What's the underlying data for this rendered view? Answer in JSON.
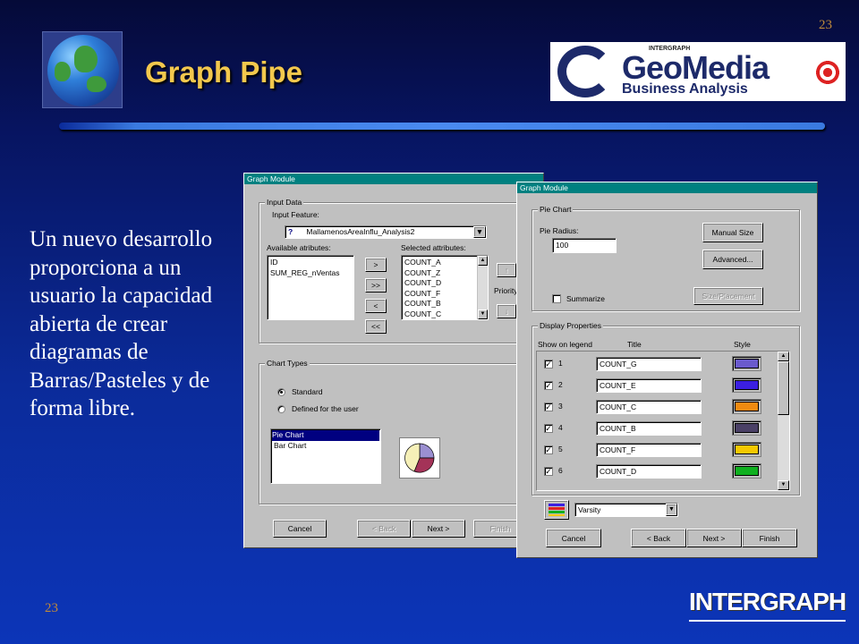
{
  "slide": {
    "page_number": "23",
    "title": "Graph Pipe",
    "body_text": "Un nuevo desarrollo proporciona a un usuario la capacidad abierta de crear diagramas de Barras/Pasteles y de forma libre.",
    "logo": {
      "small": "INTERGRAPH",
      "main": "GeoMedia",
      "sub": "Business Analysis"
    },
    "brand": "INTERGRAPH",
    "colors": {
      "title": "#f3c84d",
      "page_number": "#c08a3a",
      "titlebar": "#008080"
    }
  },
  "window1": {
    "title": "Graph Module",
    "input_data": {
      "group_label": "Input Data",
      "feature_label": "Input Feature:",
      "feature_value": "MallamenosAreaInflu_Analysis2",
      "available_label": "Available atributes:",
      "available": [
        "ID",
        "SUM_REG_nVentas"
      ],
      "selected_label": "Selected attributes:",
      "selected": [
        "COUNT_A",
        "COUNT_Z",
        "COUNT_D",
        "COUNT_F",
        "COUNT_B",
        "COUNT_C"
      ],
      "move_buttons": [
        ">",
        ">>",
        "<",
        "<<"
      ],
      "priority_label": "Priority"
    },
    "chart_types": {
      "group_label": "Chart Types",
      "standard": "Standard",
      "defined": "Defined for the user",
      "list": [
        "Pie Chart",
        "Bar Chart"
      ]
    },
    "buttons": {
      "cancel": "Cancel",
      "back": "< Back",
      "next": "Next >",
      "finish": "Finish"
    }
  },
  "window2": {
    "title": "Graph Module",
    "pie_chart": {
      "group_label": "Pie Chart",
      "radius_label": "Pie Radius:",
      "radius_value": "100",
      "manual_size": "Manual Size",
      "advanced": "Advanced...",
      "summarize": "Summarize",
      "size_placement": "Size/Placement"
    },
    "display": {
      "group_label": "Display Properties",
      "col_legend": "Show on legend",
      "col_title": "Title",
      "col_style": "Style",
      "rows": [
        {
          "num": "1",
          "title": "COUNT_G",
          "color": "#6a5acd"
        },
        {
          "num": "2",
          "title": "COUNT_E",
          "color": "#3b1fe0"
        },
        {
          "num": "3",
          "title": "COUNT_C",
          "color": "#f08a10"
        },
        {
          "num": "4",
          "title": "COUNT_B",
          "color": "#4a4066"
        },
        {
          "num": "5",
          "title": "COUNT_F",
          "color": "#f5c800"
        },
        {
          "num": "6",
          "title": "COUNT_D",
          "color": "#10b020"
        }
      ],
      "scheme": "Varsity"
    },
    "buttons": {
      "cancel": "Cancel",
      "back": "< Back",
      "next": "Next >",
      "finish": "Finish"
    }
  }
}
